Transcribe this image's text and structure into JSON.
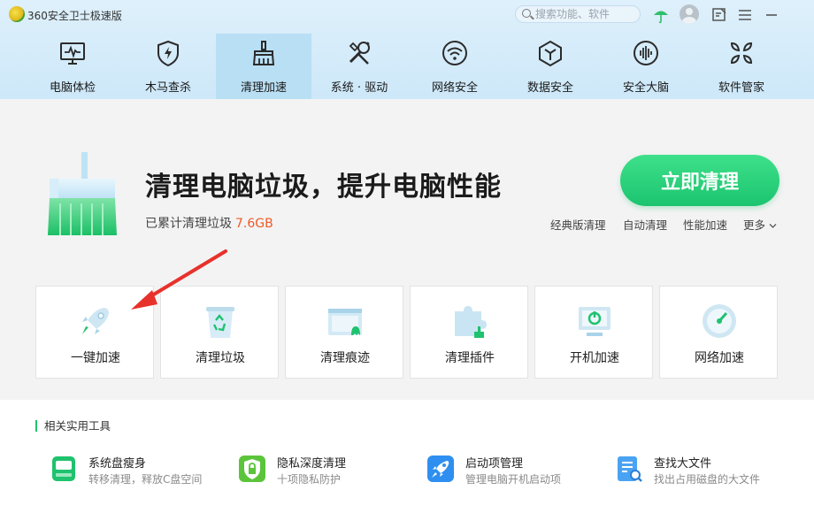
{
  "app": {
    "title": "360安全卫士极速版"
  },
  "search": {
    "placeholder": "搜索功能、软件"
  },
  "nav": [
    {
      "label": "电脑体检",
      "icon": "monitor-pulse-icon"
    },
    {
      "label": "木马查杀",
      "icon": "shield-bolt-icon"
    },
    {
      "label": "清理加速",
      "icon": "broom-icon",
      "active": true
    },
    {
      "label": "系统 · 驱动",
      "icon": "wrench-screwdriver-icon"
    },
    {
      "label": "网络安全",
      "icon": "wifi-icon"
    },
    {
      "label": "数据安全",
      "icon": "hexagon-y-icon"
    },
    {
      "label": "安全大脑",
      "icon": "brain-icon"
    },
    {
      "label": "软件管家",
      "icon": "apps-grid-icon"
    }
  ],
  "hero": {
    "headline": "清理电脑垃圾，提升电脑性能",
    "stat_label": "已累计清理垃圾",
    "stat_value": "7.6GB",
    "clean_button": "立即清理",
    "links": [
      "经典版清理",
      "自动清理",
      "性能加速",
      "更多"
    ]
  },
  "cards": [
    {
      "label": "一键加速",
      "icon": "rocket-icon"
    },
    {
      "label": "清理垃圾",
      "icon": "recycle-bin-icon"
    },
    {
      "label": "清理痕迹",
      "icon": "browser-window-icon"
    },
    {
      "label": "清理插件",
      "icon": "puzzle-broom-icon"
    },
    {
      "label": "开机加速",
      "icon": "power-monitor-icon"
    },
    {
      "label": "网络加速",
      "icon": "speedometer-icon"
    }
  ],
  "tools": {
    "title": "相关实用工具",
    "items": [
      {
        "name": "系统盘瘦身",
        "desc": "转移清理，释放C盘空间",
        "icon": "disk-icon"
      },
      {
        "name": "隐私深度清理",
        "desc": "十项隐私防护",
        "icon": "privacy-shield-icon"
      },
      {
        "name": "启动项管理",
        "desc": "管理电脑开机启动项",
        "icon": "startup-rocket-icon"
      },
      {
        "name": "查找大文件",
        "desc": "找出占用磁盘的大文件",
        "icon": "file-search-icon"
      }
    ]
  },
  "colors": {
    "accent_green": "#1fc26e",
    "stat_orange": "#f05a28",
    "header_blue": "#cde8f9",
    "active_tab": "#b9dff4"
  }
}
